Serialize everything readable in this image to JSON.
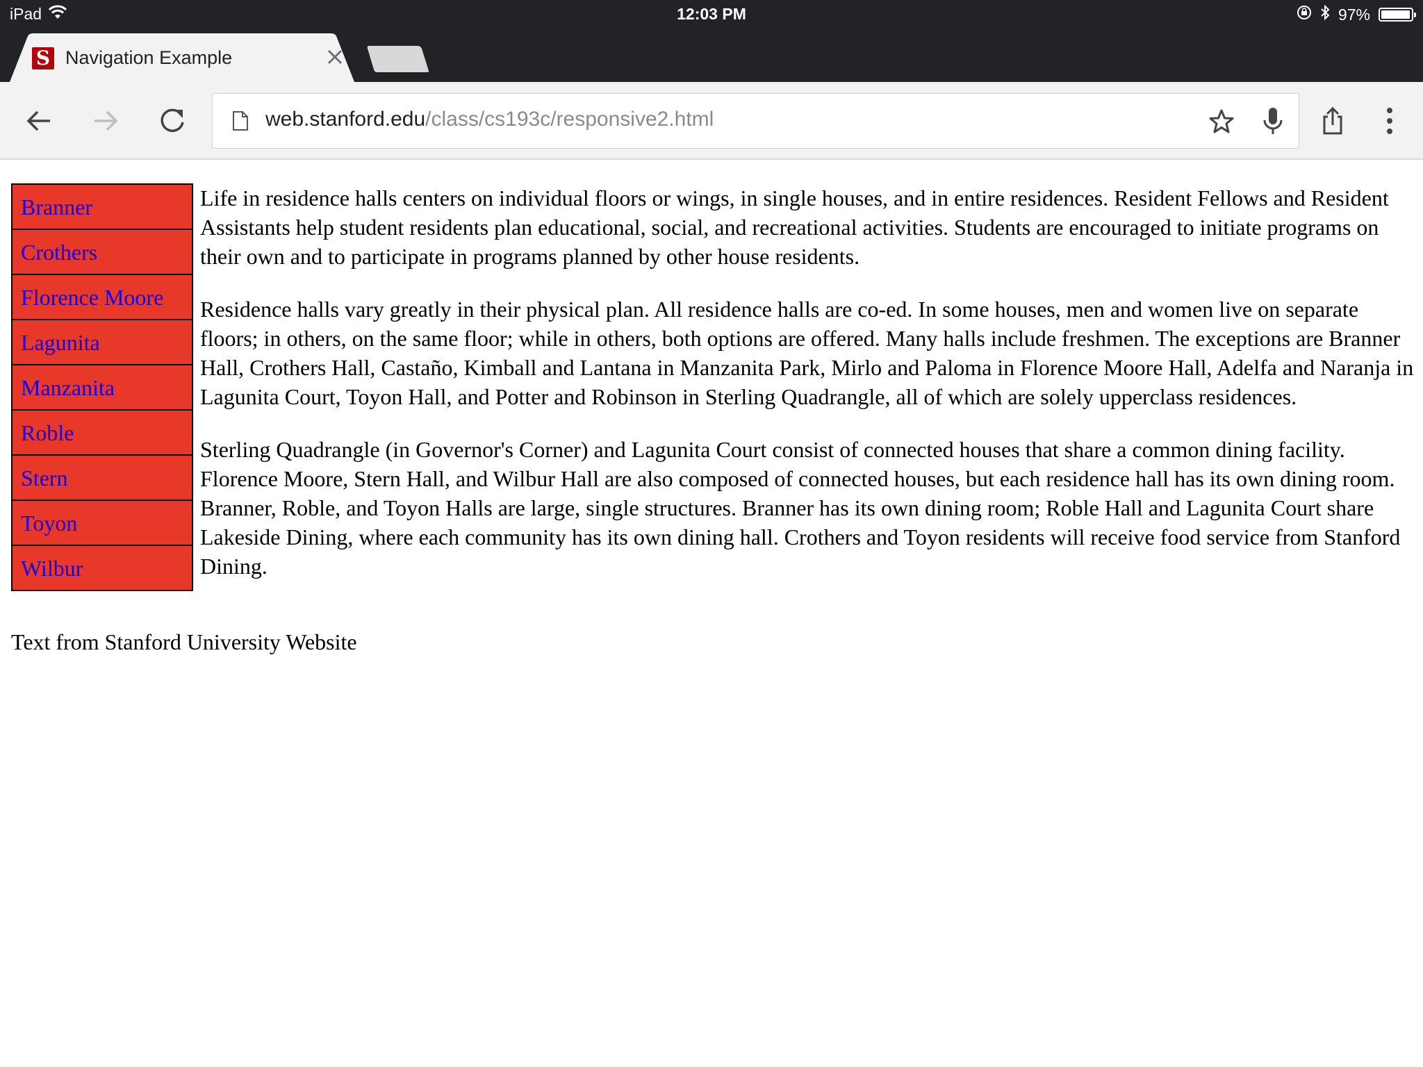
{
  "status_bar": {
    "device": "iPad",
    "time": "12:03 PM",
    "battery": "97%",
    "battery_level": 0.97
  },
  "tab": {
    "title": "Navigation Example",
    "favicon_letter": "S",
    "favicon_color": "#b1040e"
  },
  "omnibox": {
    "url_host": "web.stanford.edu",
    "url_path": "/class/cs193c/responsive2.html"
  },
  "nav": {
    "background": "#e8382a",
    "link_color": "#1b00d6",
    "items": [
      {
        "label": "Branner"
      },
      {
        "label": "Crothers"
      },
      {
        "label": "Florence Moore"
      },
      {
        "label": "Lagunita"
      },
      {
        "label": "Manzanita"
      },
      {
        "label": "Roble"
      },
      {
        "label": "Stern"
      },
      {
        "label": "Toyon"
      },
      {
        "label": "Wilbur"
      }
    ]
  },
  "main": {
    "paragraphs": [
      "Life in residence halls centers on individual floors or wings, in single houses, and in entire residences. Resident Fellows and Resident Assistants help student residents plan educational, social, and recreational activities. Students are encouraged to initiate programs on their own and to participate in programs planned by other house residents.",
      "Residence halls vary greatly in their physical plan. All residence halls are co-ed. In some houses, men and women live on separate floors; in others, on the same floor; while in others, both options are offered. Many halls include freshmen. The exceptions are Branner Hall, Crothers Hall, Castaño, Kimball and Lantana in Manzanita Park, Mirlo and Paloma in Florence Moore Hall, Adelfa and Naranja in Lagunita Court, Toyon Hall, and Potter and Robinson in Sterling Quadrangle, all of which are solely upperclass residences.",
      "Sterling Quadrangle (in Governor's Corner) and Lagunita Court consist of connected houses that share a common dining facility. Florence Moore, Stern Hall, and Wilbur Hall are also composed of connected houses, but each residence hall has its own dining room. Branner, Roble, and Toyon Halls are large, single structures. Branner has its own dining room; Roble Hall and Lagunita Court share Lakeside Dining, where each community has its own dining hall. Crothers and Toyon residents will receive food service from Stanford Dining."
    ]
  },
  "footer": {
    "note": "Text from Stanford University Website"
  }
}
